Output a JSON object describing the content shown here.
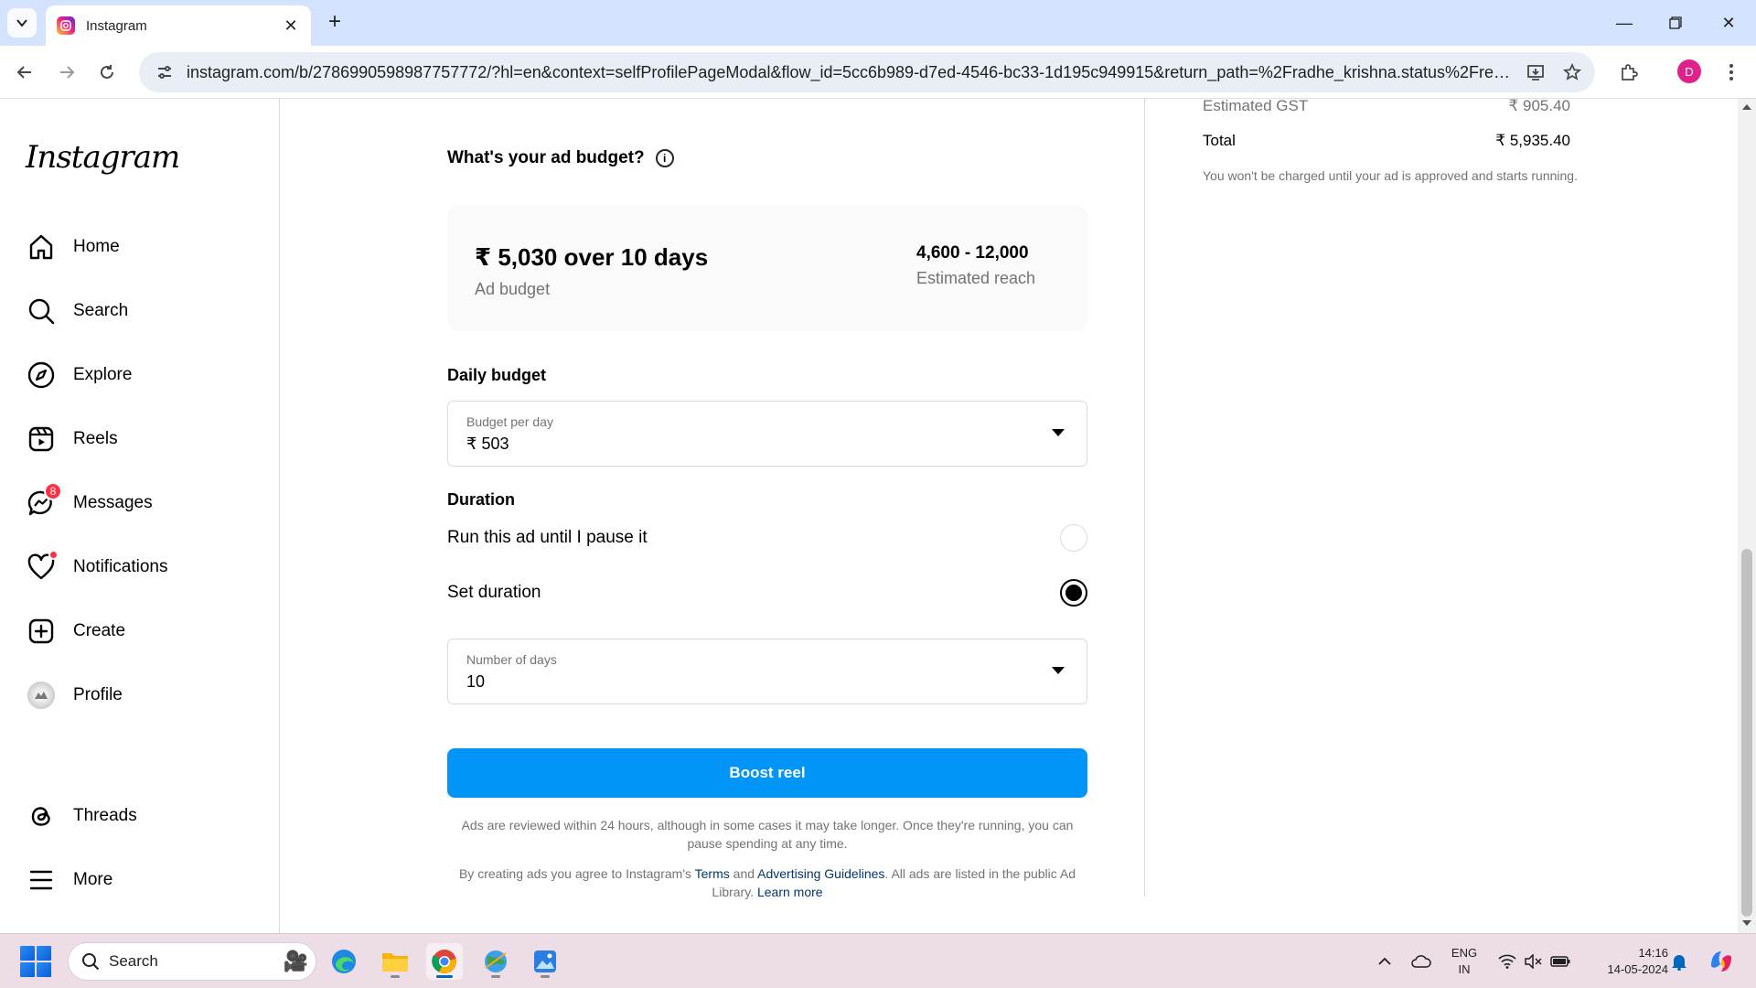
{
  "browser": {
    "tab_title": "Instagram",
    "url": "instagram.com/b/2786990598987757772/?hl=en&context=selfProfilePageModal&flow_id=5cc6b989-d7ed-4546-bc33-1d195c949915&return_path=%2Fradhe_krishna.status%2Freels%2F...",
    "profile_initial": "D"
  },
  "sidebar": {
    "logo": "Instagram",
    "items": [
      {
        "label": "Home",
        "icon": "home-icon"
      },
      {
        "label": "Search",
        "icon": "search-icon"
      },
      {
        "label": "Explore",
        "icon": "compass-icon"
      },
      {
        "label": "Reels",
        "icon": "reels-icon"
      },
      {
        "label": "Messages",
        "icon": "messenger-icon",
        "badge": "8"
      },
      {
        "label": "Notifications",
        "icon": "heart-icon"
      },
      {
        "label": "Create",
        "icon": "plus-square-icon"
      },
      {
        "label": "Profile",
        "icon": "avatar"
      },
      {
        "label": "Threads",
        "icon": "threads-icon"
      },
      {
        "label": "More",
        "icon": "menu-icon"
      }
    ]
  },
  "budget": {
    "title": "What's your ad budget?",
    "amount": "₹ 5,030 over 10 days",
    "amount_caption": "Ad budget",
    "reach": "4,600 - 12,000",
    "reach_caption": "Estimated reach",
    "daily_label": "Daily budget",
    "daily_caption": "Budget per day",
    "daily_value": "₹ 503",
    "duration_label": "Duration",
    "option_pause": "Run this ad until I pause it",
    "option_set": "Set duration",
    "days_caption": "Number of days",
    "days_value": "10",
    "button": "Boost reel",
    "review_note": "Ads are reviewed within 24 hours, although in some cases it may take longer. Once they're running, you can pause spending at any time.",
    "terms_prefix": "By creating ads you agree to Instagram's ",
    "terms_link": "Terms",
    "terms_and": " and ",
    "guidelines_link": "Advertising Guidelines",
    "terms_suffix": ". All ads are listed in the public Ad Library. ",
    "learn_more": "Learn more"
  },
  "summary": {
    "gst_label": "Estimated GST",
    "gst_value": "₹ 905.40",
    "total_label": "Total",
    "total_value": "₹ 5,935.40",
    "note": "You won't be charged until your ad is approved and starts running."
  },
  "taskbar": {
    "search": "Search",
    "lang_top": "ENG",
    "lang_bottom": "IN",
    "time": "14:16",
    "date": "14-05-2024"
  },
  "colors": {
    "accent": "#0095f6",
    "link": "#00376b",
    "badge": "#ff3040"
  }
}
